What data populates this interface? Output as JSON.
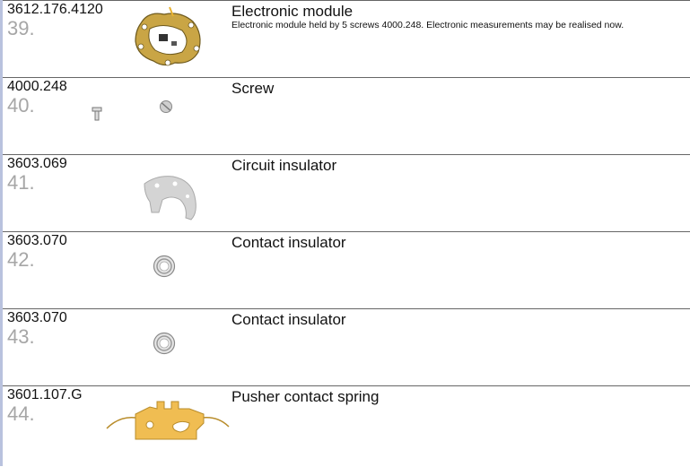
{
  "parts": [
    {
      "ref": "3612.176.4120",
      "num": "39.",
      "name": "Electronic module",
      "desc": "Electronic module held by 5 screws 4000.248. Electronic measurements may be realised now.",
      "icon": "electronic-module-icon"
    },
    {
      "ref": "4000.248",
      "num": "40.",
      "name": "Screw",
      "icon": "screw-icon"
    },
    {
      "ref": "3603.069",
      "num": "41.",
      "name": "Circuit insulator",
      "icon": "circuit-insulator-icon"
    },
    {
      "ref": "3603.070",
      "num": "42.",
      "name": "Contact insulator",
      "icon": "contact-insulator-icon"
    },
    {
      "ref": "3603.070",
      "num": "43.",
      "name": "Contact insulator",
      "icon": "contact-insulator-icon"
    },
    {
      "ref": "3601.107.G",
      "num": "44.",
      "name": "Pusher contact spring",
      "icon": "pusher-contact-spring-icon"
    }
  ],
  "colors": {
    "gold": "#e8b54a",
    "grey_text": "#a6a6a6",
    "sidebar": "#b9c2de"
  }
}
